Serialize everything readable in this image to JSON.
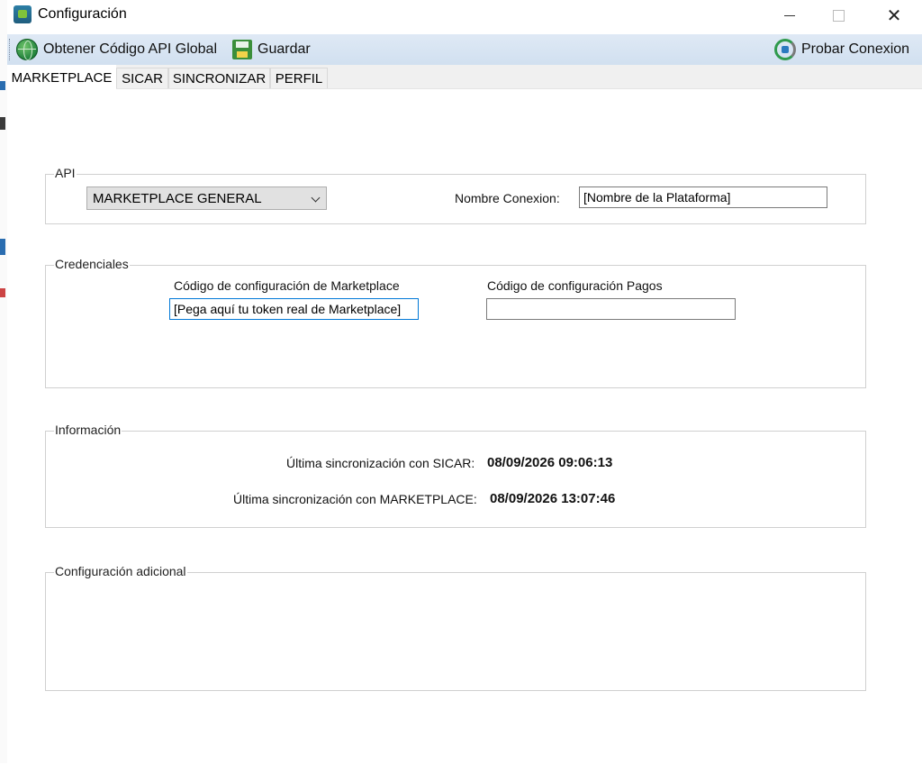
{
  "window": {
    "title": "Configuración"
  },
  "toolbar": {
    "api_label": "Obtener Código API Global",
    "save_label": "Guardar",
    "test_label": "Probar Conexion"
  },
  "tabs": [
    {
      "label": "MARKETPLACE",
      "active": true
    },
    {
      "label": "SICAR"
    },
    {
      "label": "SINCRONIZAR"
    },
    {
      "label": "PERFIL"
    }
  ],
  "api": {
    "legend": "API",
    "selected": "MARKETPLACE GENERAL",
    "connection_label": "Nombre Conexion:",
    "connection_value": "[Nombre de la Plataforma]"
  },
  "credenciales": {
    "legend": "Credenciales",
    "marketplace_label": "Código de configuración de Marketplace",
    "marketplace_value": "[Pega aquí tu token real de Marketplace]",
    "pagos_label": "Código de configuración Pagos",
    "pagos_value": ""
  },
  "informacion": {
    "legend": "Información",
    "sicar_label": "Última sincronización con SICAR:",
    "sicar_value": "08/09/2026 09:06:13",
    "marketplace_label": "Última sincronización con MARKETPLACE:",
    "marketplace_value": "08/09/2026 13:07:46"
  },
  "adicional": {
    "legend": "Configuración adicional"
  },
  "colors": {
    "accent": "#d81c3a",
    "toolbar": "#d8e4f2"
  }
}
